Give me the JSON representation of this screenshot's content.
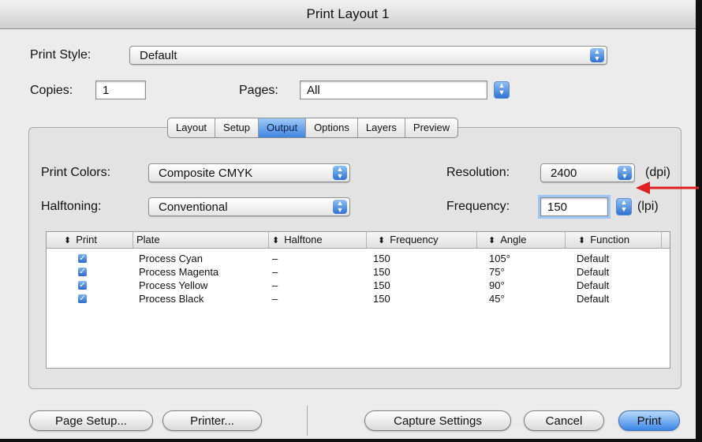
{
  "window": {
    "title": "Print Layout 1"
  },
  "print_style": {
    "label": "Print Style:",
    "value": "Default"
  },
  "copies": {
    "label": "Copies:",
    "value": "1"
  },
  "pages": {
    "label": "Pages:",
    "value": "All"
  },
  "tabs": [
    "Layout",
    "Setup",
    "Output",
    "Options",
    "Layers",
    "Preview"
  ],
  "active_tab": "Output",
  "output": {
    "print_colors": {
      "label": "Print Colors:",
      "value": "Composite CMYK"
    },
    "halftoning": {
      "label": "Halftoning:",
      "value": "Conventional"
    },
    "resolution": {
      "label": "Resolution:",
      "value": "2400",
      "unit": "(dpi)"
    },
    "frequency": {
      "label": "Frequency:",
      "value": "150",
      "unit": "(lpi)"
    }
  },
  "table": {
    "headers": {
      "sort_glyph": "⬍",
      "print": "Print",
      "plate": "Plate",
      "halftone": "Halftone",
      "frequency": "Frequency",
      "angle": "Angle",
      "function": "Function"
    },
    "rows": [
      {
        "plate": "Process Cyan",
        "halftone": "–",
        "frequency": "150",
        "angle": "105°",
        "function": "Default"
      },
      {
        "plate": "Process Magenta",
        "halftone": "–",
        "frequency": "150",
        "angle": "75°",
        "function": "Default"
      },
      {
        "plate": "Process Yellow",
        "halftone": "–",
        "frequency": "150",
        "angle": "90°",
        "function": "Default"
      },
      {
        "plate": "Process Black",
        "halftone": "–",
        "frequency": "150",
        "angle": "45°",
        "function": "Default"
      }
    ]
  },
  "buttons": {
    "page_setup": "Page Setup...",
    "printer": "Printer...",
    "capture_settings": "Capture Settings",
    "cancel": "Cancel",
    "print": "Print"
  },
  "colors": {
    "accent": "#3a86e6",
    "annotation_arrow": "#e02020"
  }
}
